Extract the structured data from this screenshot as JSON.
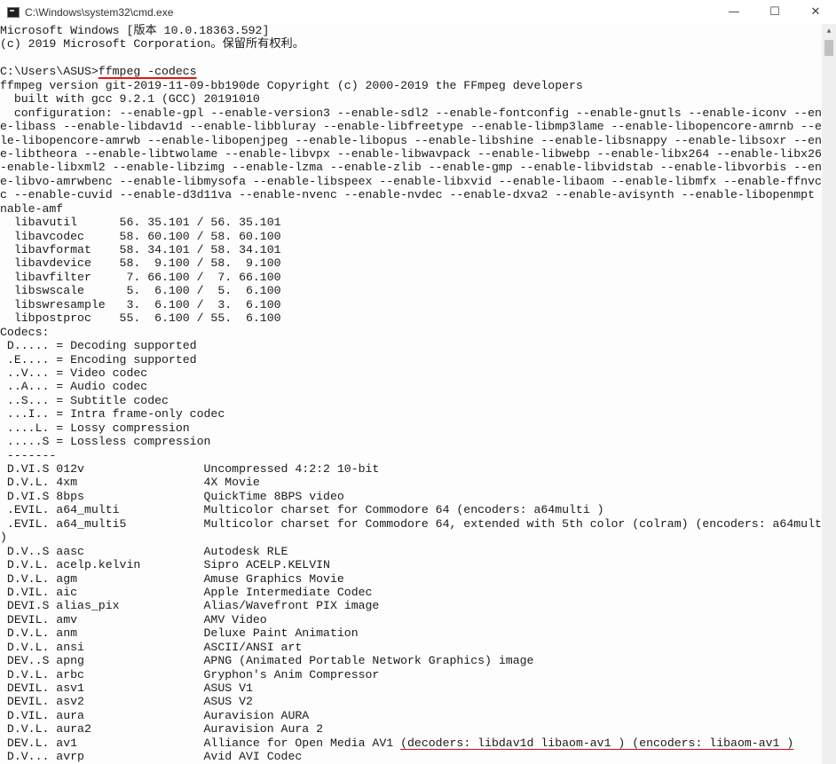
{
  "window": {
    "title": "C:\\Windows\\system32\\cmd.exe",
    "minimize": "—",
    "maximize": "☐",
    "close": "✕"
  },
  "icons": {
    "app": "cmd-icon",
    "scroll_up": "▲",
    "scroll_down": "▼"
  },
  "colors": {
    "annotation": "#d0101a",
    "text": "#1a1a1a",
    "background": "#fdfdfd"
  },
  "console": {
    "lines": [
      "Microsoft Windows [版本 10.0.18363.592]",
      "(c) 2019 Microsoft Corporation。保留所有权利。",
      "",
      "C:\\Users\\ASUS>ffmpeg -codecs",
      "ffmpeg version git-2019-11-09-bb190de Copyright (c) 2000-2019 the FFmpeg developers",
      "  built with gcc 9.2.1 (GCC) 20191010",
      "  configuration: --enable-gpl --enable-version3 --enable-sdl2 --enable-fontconfig --enable-gnutls --enable-iconv --enabl",
      "e-libass --enable-libdav1d --enable-libbluray --enable-libfreetype --enable-libmp3lame --enable-libopencore-amrnb --enab",
      "le-libopencore-amrwb --enable-libopenjpeg --enable-libopus --enable-libshine --enable-libsnappy --enable-libsoxr --enabl",
      "e-libtheora --enable-libtwolame --enable-libvpx --enable-libwavpack --enable-libwebp --enable-libx264 --enable-libx265 -",
      "-enable-libxml2 --enable-libzimg --enable-lzma --enable-zlib --enable-gmp --enable-libvidstab --enable-libvorbis --enabl",
      "e-libvo-amrwbenc --enable-libmysofa --enable-libspeex --enable-libxvid --enable-libaom --enable-libmfx --enable-ffnvcode",
      "c --enable-cuvid --enable-d3d11va --enable-nvenc --enable-nvdec --enable-dxva2 --enable-avisynth --enable-libopenmpt --e",
      "nable-amf",
      "  libavutil      56. 35.101 / 56. 35.101",
      "  libavcodec     58. 60.100 / 58. 60.100",
      "  libavformat    58. 34.101 / 58. 34.101",
      "  libavdevice    58.  9.100 / 58.  9.100",
      "  libavfilter     7. 66.100 /  7. 66.100",
      "  libswscale      5.  6.100 /  5.  6.100",
      "  libswresample   3.  6.100 /  3.  6.100",
      "  libpostproc    55.  6.100 / 55.  6.100",
      "Codecs:",
      " D..... = Decoding supported",
      " .E.... = Encoding supported",
      " ..V... = Video codec",
      " ..A... = Audio codec",
      " ..S... = Subtitle codec",
      " ...I.. = Intra frame-only codec",
      " ....L. = Lossy compression",
      " .....S = Lossless compression",
      " -------",
      " D.VI.S 012v                 Uncompressed 4:2:2 10-bit",
      " D.V.L. 4xm                  4X Movie",
      " D.VI.S 8bps                 QuickTime 8BPS video",
      " .EVIL. a64_multi            Multicolor charset for Commodore 64 (encoders: a64multi )",
      " .EVIL. a64_multi5           Multicolor charset for Commodore 64, extended with 5th color (colram) (encoders: a64multi5",
      ")",
      " D.V..S aasc                 Autodesk RLE",
      " D.V.L. acelp.kelvin         Sipro ACELP.KELVIN",
      " D.V.L. agm                  Amuse Graphics Movie",
      " D.VIL. aic                  Apple Intermediate Codec",
      " DEVI.S alias_pix            Alias/Wavefront PIX image",
      " DEVIL. amv                  AMV Video",
      " D.V.L. anm                  Deluxe Paint Animation",
      " D.V.L. ansi                 ASCII/ANSI art",
      " DEV..S apng                 APNG (Animated Portable Network Graphics) image",
      " D.V.L. arbc                 Gryphon's Anim Compressor",
      " DEVIL. asv1                 ASUS V1",
      " DEVIL. asv2                 ASUS V2",
      " D.VIL. aura                 Auravision AURA",
      " D.V.L. aura2                Auravision Aura 2",
      " DEV.L. av1                  Alliance for Open Media AV1 ",
      " D.V... avrp                 Avid AVI Codec"
    ],
    "cmd_prompt": "C:\\Users\\ASUS>",
    "cmd_text": "ffmpeg -codecs",
    "av1_annotated": "(decoders: libdav1d libaom-av1 ) (encoders: libaom-av1 )"
  }
}
